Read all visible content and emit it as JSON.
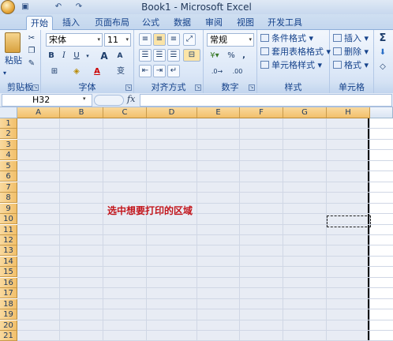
{
  "title": "Book1 - Microsoft Excel",
  "quick_access": [
    "save-icon",
    "undo-icon",
    "redo-icon"
  ],
  "tabs": [
    {
      "label": "开始",
      "active": true
    },
    {
      "label": "插入"
    },
    {
      "label": "页面布局"
    },
    {
      "label": "公式"
    },
    {
      "label": "数据"
    },
    {
      "label": "审阅"
    },
    {
      "label": "视图"
    },
    {
      "label": "开发工具"
    }
  ],
  "ribbon": {
    "clipboard": {
      "label": "剪贴板",
      "paste": "粘贴"
    },
    "font": {
      "label": "字体",
      "name": "宋体",
      "size": "11",
      "bold": "B",
      "italic": "I",
      "underline": "U",
      "grow": "A",
      "shrink": "A",
      "font_color": "A",
      "phonetic": "变"
    },
    "alignment": {
      "label": "对齐方式"
    },
    "number": {
      "label": "数字",
      "format": "常规",
      "percent": "%",
      "comma": ","
    },
    "styles": {
      "label": "样式",
      "conditional": "条件格式",
      "table": "套用表格格式",
      "cell": "单元格样式"
    },
    "cells": {
      "label": "单元格",
      "insert": "插入",
      "delete": "删除",
      "format": "格式"
    },
    "editing": {
      "sum": "Σ"
    }
  },
  "formula_bar": {
    "name_box": "H32",
    "fx": "fx",
    "value": ""
  },
  "sheet": {
    "columns": [
      "A",
      "B",
      "C",
      "D",
      "E",
      "F",
      "G",
      "H"
    ],
    "rows": [
      "1",
      "2",
      "3",
      "4",
      "5",
      "6",
      "7",
      "8",
      "9",
      "10",
      "11",
      "12",
      "13",
      "14",
      "15",
      "16",
      "17",
      "18",
      "19",
      "20",
      "21"
    ],
    "annotation": "选中想要打印的区域"
  },
  "colors": {
    "accent": "#15428b",
    "annotation": "#c3161c",
    "header_selected": "#f2c06b"
  }
}
